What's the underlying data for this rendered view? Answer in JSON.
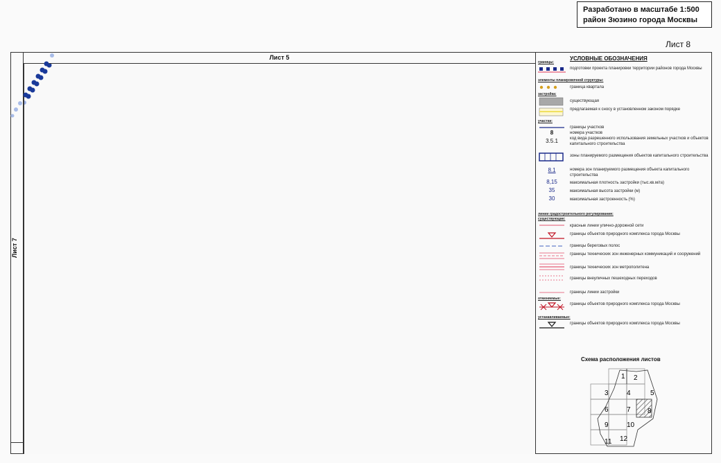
{
  "stamp": {
    "line1": "Разработано в масштабе 1:500",
    "line2": "район Зюзино города Москвы"
  },
  "sheet_label": "Лист 8",
  "top_neighbor": "Лист 5",
  "left_neighbor": "Лист 7",
  "legend": {
    "title": "УСЛОВНЫЕ ОБОЗНАЧЕНИЯ",
    "cat_borders": "границы:",
    "item_project_borders": "подготовки проекта планировки территории районов города Москвы",
    "cat_planning": "элементы планировочной структуры:",
    "item_quarter": "граница квартала",
    "cat_building": "застройка:",
    "item_existing": "существующая",
    "item_demolition": "предлагаемая к сносу в установленном законом порядке",
    "cat_plots": "участки:",
    "item_plot_borders": "границы участков",
    "code_plot_number": "8",
    "item_plot_numbers": "номера участков",
    "code_use": "3.5.1",
    "item_use_code": "код вида разрешенного использования земельных участков и объектов капитального строительства",
    "item_zones": "зоны планируемого размещения объектов капитального строительства",
    "code_zone": "8.1",
    "item_zone_numbers": "номера зон планируемого размещения объекта капитального строительства",
    "code_density": "8,15",
    "item_density": "максимальная плотность застройки (тыс.кв.м/га)",
    "code_height": "35",
    "item_height": "максимальная высота застройки (м)",
    "code_coverage": "30",
    "item_coverage": "максимальная застроенность (%)",
    "cat_regulation": "линии градостроительного регулирования:",
    "cat_existing": "существующие:",
    "item_red_lines": "красные линии улично-дорожной сети",
    "item_nature_borders": "границы объектов природного комплекса города Москвы",
    "item_shore": "границы береговых полос",
    "item_tech_zones": "границы технических зон инженерных коммуникаций и сооружений",
    "item_metro": "границы технических зон метрополитена",
    "item_crossings": "границы внеуличных пешеходных переходов",
    "item_build_lines": "границы линии застройки",
    "cat_cancelled": "отменяемые:",
    "item_nature_cancelled": "границы объектов природного комплекса города Москвы",
    "cat_established": "устанавливаемые:",
    "item_nature_established": "границы объектов природного комплекса города Москвы"
  },
  "scheme": {
    "title": "Схема расположения листов",
    "cells": [
      "1",
      "2",
      "3",
      "4",
      "5",
      "6",
      "7",
      "8",
      "9",
      "10",
      "11",
      "12"
    ]
  },
  "colors": {
    "red_line": "#e8748a",
    "blue": "#1a2a8a",
    "gold": "#d4a020",
    "grey_fill": "#a8a8a8",
    "yellow": "#f0e060"
  }
}
